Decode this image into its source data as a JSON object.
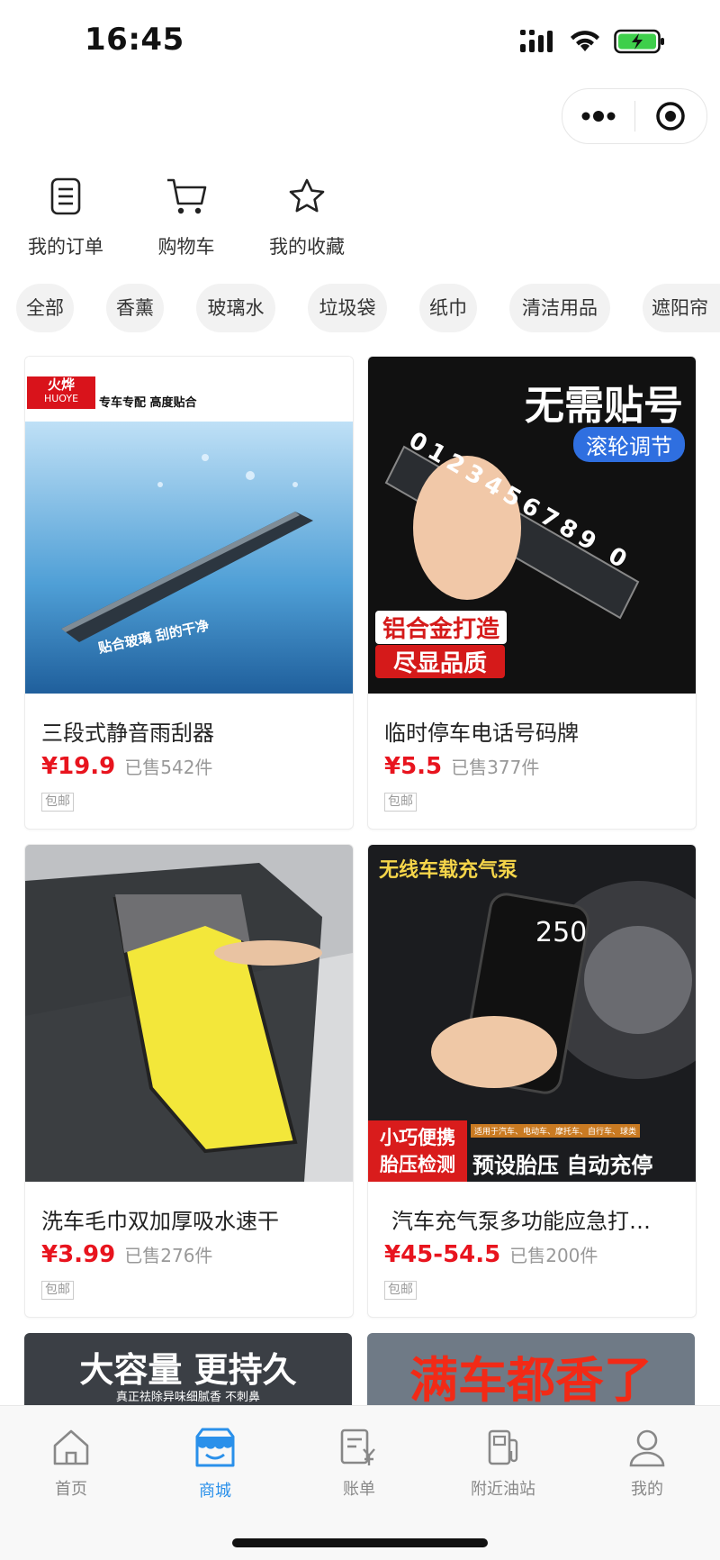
{
  "status": {
    "time": "16:45"
  },
  "quick_nav": [
    {
      "label": "我的订单",
      "icon": "order-list-icon"
    },
    {
      "label": "购物车",
      "icon": "cart-icon"
    },
    {
      "label": "我的收藏",
      "icon": "star-icon"
    }
  ],
  "categories": [
    "全部",
    "香薰",
    "玻璃水",
    "垃圾袋",
    "纸巾",
    "清洁用品",
    "遮阳帘"
  ],
  "products": [
    {
      "title": "三段式静音雨刮器",
      "price": "¥19.9",
      "sold": "已售542件",
      "tag": "包邮",
      "image_text": {
        "brand": "火烨",
        "brand_en": "HUOYE",
        "banner": "专车专配 高度贴合",
        "caption": "贴合玻璃 刮的干净"
      }
    },
    {
      "title": "临时停车电话号码牌",
      "price": "¥5.5",
      "sold": "已售377件",
      "tag": "包邮",
      "image_text": {
        "headline": "无需贴号",
        "badge": "滚轮调节",
        "digits": "0123456789 0",
        "bottom1": "铝合金打造",
        "bottom2": "尽显品质"
      }
    },
    {
      "title": "洗车毛巾双加厚吸水速干",
      "price": "¥3.99",
      "sold": "已售276件",
      "tag": "包邮"
    },
    {
      "title": "汽车充气泵多功能应急打…",
      "price": "¥45-54.5",
      "sold": "已售200件",
      "tag": "包邮",
      "image_text": {
        "headline": "无线车载充气泵",
        "display": "250",
        "left1": "小巧便携",
        "left2": "胎压检测",
        "small": "适用于汽车、电动车、摩托车、自行车、球类",
        "right": "预设胎压 自动充停"
      }
    }
  ],
  "partial_cards": [
    {
      "headline": "大容量 更持久",
      "sub": "真正祛除异味细腻香 不刺鼻"
    },
    {
      "headline": "满车都香了"
    }
  ],
  "tabbar": [
    {
      "label": "首页",
      "icon": "home-icon",
      "active": false
    },
    {
      "label": "商城",
      "icon": "shop-icon",
      "active": true
    },
    {
      "label": "账单",
      "icon": "bill-icon",
      "active": false
    },
    {
      "label": "附近油站",
      "icon": "gas-station-icon",
      "active": false
    },
    {
      "label": "我的",
      "icon": "user-icon",
      "active": false
    }
  ],
  "colors": {
    "accent": "#2a90ea",
    "price": "#e8141e"
  }
}
